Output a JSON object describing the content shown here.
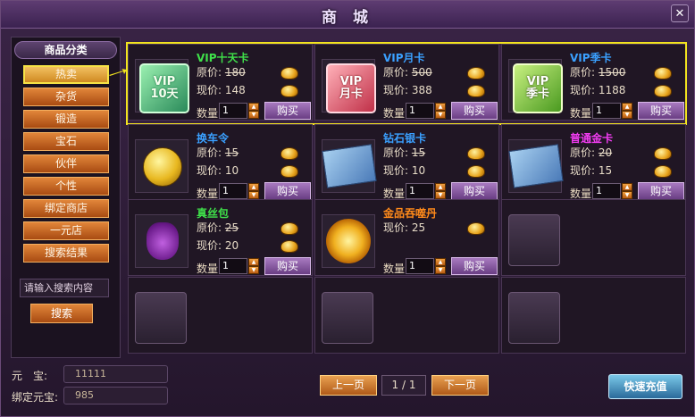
{
  "window": {
    "title": "商 城",
    "close_glyph": "✕"
  },
  "sidebar": {
    "title": "商品分类",
    "categories": [
      "热卖",
      "杂货",
      "锻造",
      "宝石",
      "伙伴",
      "个性",
      "绑定商店",
      "一元店",
      "搜索结果"
    ],
    "active_index": 0,
    "search_placeholder": "请输入搜索内容",
    "search_button": "搜索"
  },
  "labels": {
    "original": "原价:",
    "current": "现价:",
    "quantity": "数量",
    "buy": "购买"
  },
  "items": [
    {
      "name": "VIP十天卡",
      "name_color": "#3fe04a",
      "icon": "vip-ten-day-card-icon",
      "card_text": [
        "VIP",
        "10天"
      ],
      "original_price": "180",
      "price": "148",
      "qty": "1"
    },
    {
      "name": "VIP月卡",
      "name_color": "#3aa0ff",
      "icon": "vip-month-card-icon",
      "card_text": [
        "VIP",
        "月卡"
      ],
      "original_price": "500",
      "price": "388",
      "qty": "1"
    },
    {
      "name": "VIP季卡",
      "name_color": "#3aa0ff",
      "icon": "vip-season-card-icon",
      "card_text": [
        "VIP",
        "季卡"
      ],
      "original_price": "1500",
      "price": "1188",
      "qty": "1"
    },
    {
      "name": "换车令",
      "name_color": "#3aa0ff",
      "icon": "gold-token-icon",
      "original_price": "15",
      "price": "10",
      "qty": "1"
    },
    {
      "name": "钻石银卡",
      "name_color": "#3aa0ff",
      "icon": "diamond-silver-card-icon",
      "original_price": "15",
      "price": "10",
      "qty": "1"
    },
    {
      "name": "普通金卡",
      "name_color": "#f03cf0",
      "icon": "gold-card-icon",
      "original_price": "20",
      "price": "15",
      "qty": "1"
    },
    {
      "name": "真丝包",
      "name_color": "#3fe04a",
      "icon": "silk-bag-icon",
      "original_price": "25",
      "price": "20",
      "qty": "1"
    },
    {
      "name": "金品吞噬丹",
      "name_color": "#ff8a1a",
      "icon": "golden-pill-icon",
      "price": "25",
      "qty": "1"
    }
  ],
  "currency": {
    "yuanbao_label": "元　宝:",
    "yuanbao_value": "11111",
    "bound_label": "绑定元宝:",
    "bound_value": "985"
  },
  "pagination": {
    "prev": "上一页",
    "indicator": "1 / 1",
    "next": "下一页"
  },
  "recharge_button": "快速充值"
}
